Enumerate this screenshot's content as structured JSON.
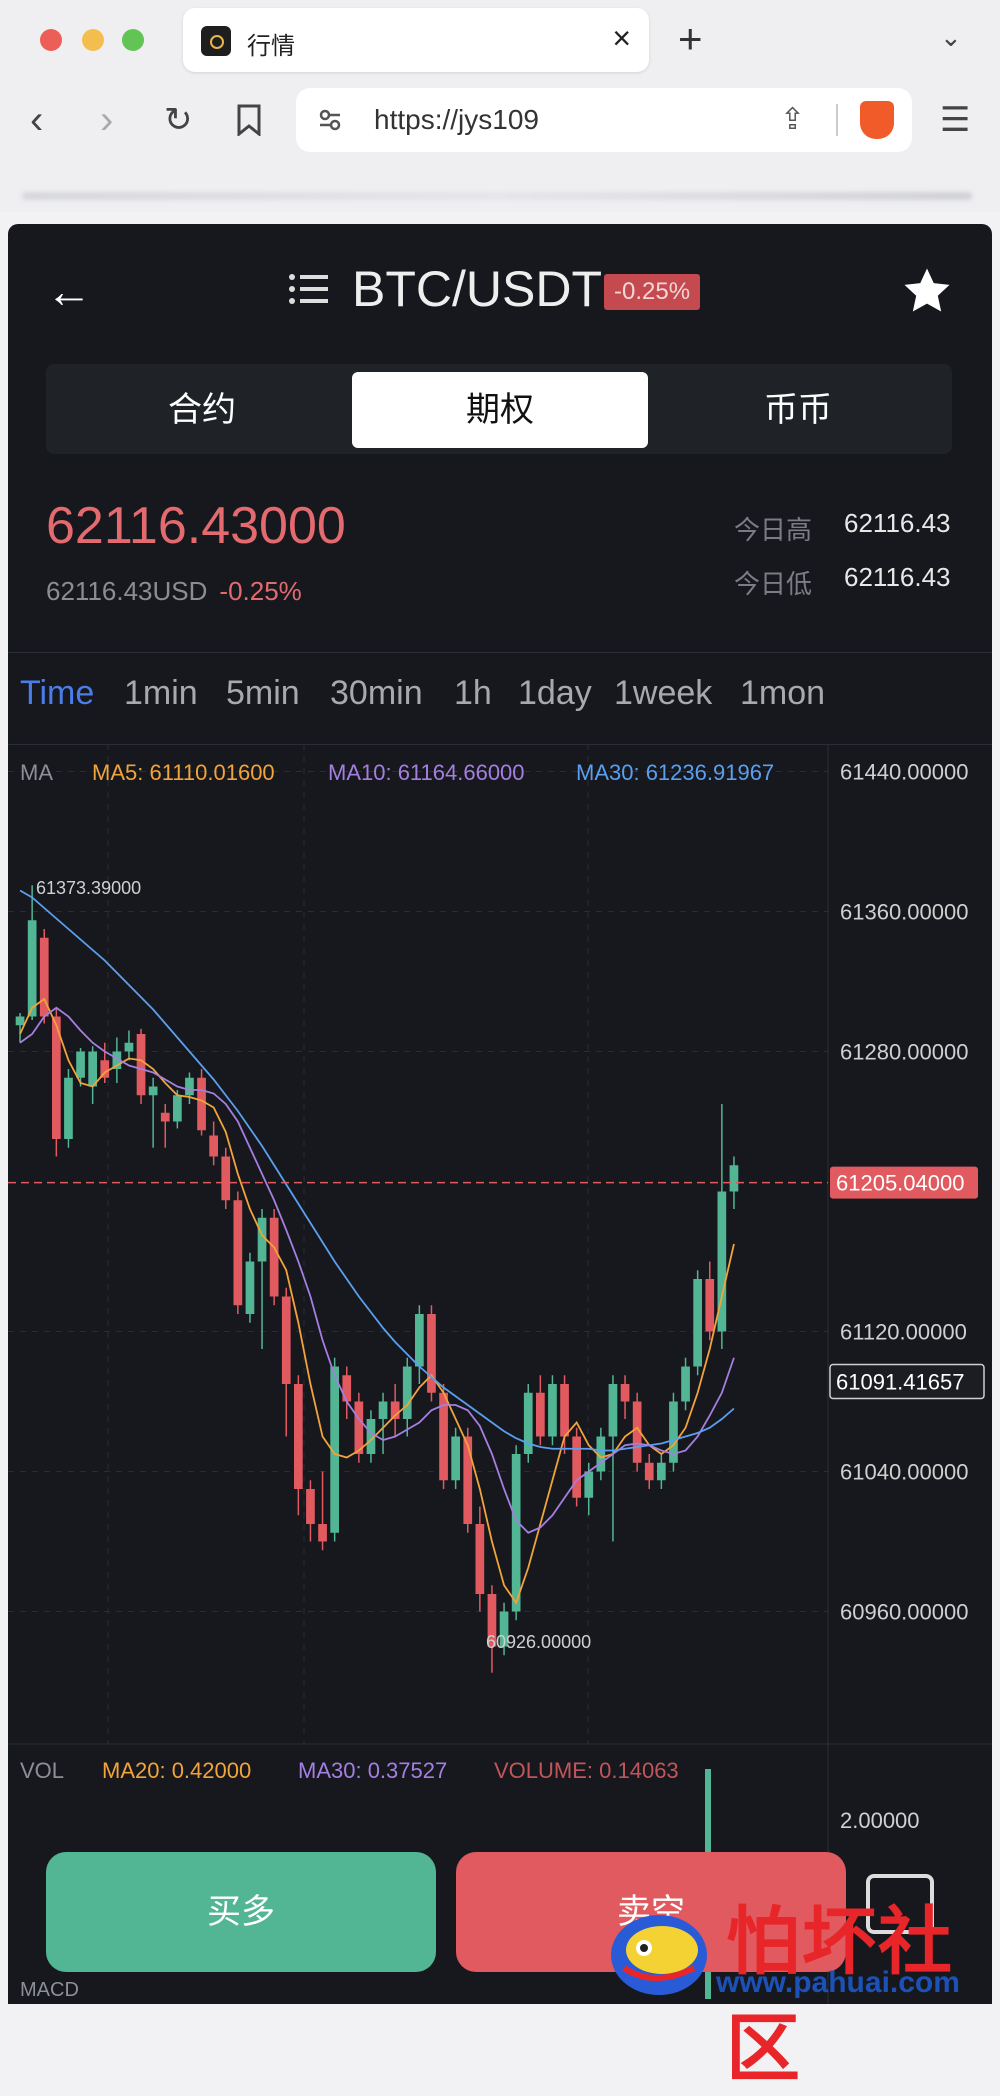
{
  "browser": {
    "tab_title": "行情",
    "tab_close": "×",
    "new_tab": "+",
    "url": "https://jys109"
  },
  "header": {
    "pair": "BTC/USDT",
    "change": "-0.25%"
  },
  "segments": [
    {
      "label": "合约",
      "active": false
    },
    {
      "label": "期权",
      "active": true
    },
    {
      "label": "币币",
      "active": false
    }
  ],
  "ticker": {
    "price": "62116.43000",
    "usd": "62116.43USD",
    "change": "-0.25%",
    "high_label": "今日高",
    "high_value": "62116.43",
    "low_label": "今日低",
    "low_value": "62116.43"
  },
  "timeframes": [
    "Time",
    "1min",
    "5min",
    "30min",
    "1h",
    "1day",
    "1week",
    "1mon"
  ],
  "active_timeframe": "Time",
  "chart_data": {
    "type": "candlestick",
    "ma_label": "MA",
    "ma5_text": "MA5: 61110.01600",
    "ma10_text": "MA10: 61164.66000",
    "ma30_text": "MA30: 61236.91967",
    "y_ticks": [
      "61440.00000",
      "61360.00000",
      "61280.00000",
      "61120.00000",
      "61040.00000",
      "60960.00000"
    ],
    "ylim": [
      60890,
      61450
    ],
    "last_price_label": "61205.04000",
    "cursor_price_label": "61091.41657",
    "last_price": 61205.04,
    "cursor_price": 61091.41657,
    "high_label": "61373.39000",
    "low_label": "60926.00000",
    "candles": [
      [
        61295,
        61300,
        61285,
        61302
      ],
      [
        61300,
        61355,
        61298,
        61375
      ],
      [
        61345,
        61300,
        61296,
        61350
      ],
      [
        61300,
        61230,
        61220,
        61305
      ],
      [
        61230,
        61265,
        61225,
        61270
      ],
      [
        61265,
        61280,
        61260,
        61282
      ],
      [
        61260,
        61280,
        61250,
        61283
      ],
      [
        61275,
        61265,
        61262,
        61285
      ],
      [
        61270,
        61280,
        61262,
        61288
      ],
      [
        61280,
        61285,
        61275,
        61292
      ],
      [
        61290,
        61255,
        61250,
        61293
      ],
      [
        61255,
        61260,
        61225,
        61265
      ],
      [
        61245,
        61240,
        61225,
        61250
      ],
      [
        61240,
        61255,
        61236,
        61258
      ],
      [
        61255,
        61265,
        61250,
        61268
      ],
      [
        61265,
        61235,
        61232,
        61270
      ],
      [
        61232,
        61220,
        61215,
        61240
      ],
      [
        61220,
        61195,
        61190,
        61225
      ],
      [
        61195,
        61135,
        61130,
        61200
      ],
      [
        61130,
        61160,
        61125,
        61165
      ],
      [
        61160,
        61185,
        61110,
        61190
      ],
      [
        61185,
        61140,
        61135,
        61190
      ],
      [
        61140,
        61090,
        61060,
        61145
      ],
      [
        61090,
        61030,
        61015,
        61095
      ],
      [
        61030,
        61010,
        61000,
        61035
      ],
      [
        61010,
        61000,
        60995,
        61040
      ],
      [
        61005,
        61100,
        61000,
        61105
      ],
      [
        61095,
        61080,
        61070,
        61100
      ],
      [
        61080,
        61050,
        61045,
        61085
      ],
      [
        61050,
        61070,
        61045,
        61075
      ],
      [
        61070,
        61080,
        61050,
        61085
      ],
      [
        61080,
        61070,
        61060,
        61090
      ],
      [
        61070,
        61100,
        61060,
        61105
      ],
      [
        61100,
        61130,
        61090,
        61135
      ],
      [
        61130,
        61085,
        61080,
        61135
      ],
      [
        61085,
        61035,
        61030,
        61090
      ],
      [
        61035,
        61060,
        61030,
        61065
      ],
      [
        61060,
        61010,
        61005,
        61065
      ],
      [
        61010,
        60970,
        60960,
        61020
      ],
      [
        60970,
        60940,
        60925,
        60975
      ],
      [
        60940,
        60960,
        60935,
        60965
      ],
      [
        60960,
        61050,
        60955,
        61055
      ],
      [
        61050,
        61085,
        61045,
        61090
      ],
      [
        61085,
        61060,
        61055,
        61095
      ],
      [
        61060,
        61090,
        61055,
        61095
      ],
      [
        61090,
        61060,
        61050,
        61095
      ],
      [
        61060,
        61025,
        61020,
        61065
      ],
      [
        61025,
        61040,
        61015,
        61045
      ],
      [
        61040,
        61060,
        61035,
        61065
      ],
      [
        61060,
        61090,
        61000,
        61095
      ],
      [
        61090,
        61080,
        61070,
        61095
      ],
      [
        61080,
        61045,
        61040,
        61085
      ],
      [
        61045,
        61035,
        61030,
        61050
      ],
      [
        61035,
        61045,
        61030,
        61050
      ],
      [
        61045,
        61080,
        61040,
        61085
      ],
      [
        61080,
        61100,
        61075,
        61105
      ],
      [
        61100,
        61150,
        61095,
        61155
      ],
      [
        61150,
        61120,
        61115,
        61160
      ],
      [
        61120,
        61200,
        61110,
        61250
      ],
      [
        61200,
        61215,
        61190,
        61220
      ]
    ],
    "ma5": [
      61290,
      61305,
      61310,
      61295,
      61275,
      61262,
      61260,
      61268,
      61272,
      61276,
      61275,
      61270,
      61262,
      61255,
      61254,
      61252,
      61248,
      61234,
      61210,
      61190,
      61175,
      61168,
      61155,
      61125,
      61090,
      61060,
      61050,
      61048,
      61052,
      61058,
      61065,
      61072,
      61078,
      61088,
      61095,
      61085,
      61070,
      61055,
      61030,
      61000,
      60975,
      60965,
      60985,
      61010,
      61035,
      61060,
      61068,
      61055,
      61048,
      61050,
      61060,
      61065,
      61055,
      61050,
      61055,
      61065,
      61085,
      61110,
      61140,
      61170
    ],
    "ma10": [
      61285,
      61290,
      61300,
      61305,
      61300,
      61292,
      61285,
      61280,
      61276,
      61272,
      61270,
      61268,
      61264,
      61260,
      61258,
      61258,
      61256,
      61250,
      61240,
      61225,
      61210,
      61195,
      61178,
      61160,
      61140,
      61115,
      61095,
      61080,
      61070,
      61062,
      61058,
      61060,
      61064,
      61068,
      61075,
      61078,
      61078,
      61075,
      61066,
      61050,
      61030,
      61012,
      61005,
      61008,
      61015,
      61025,
      61035,
      61040,
      61045,
      61050,
      61055,
      61056,
      61055,
      61052,
      61050,
      61052,
      61060,
      61072,
      61085,
      61105
    ],
    "ma30": [
      61372,
      61368,
      61362,
      61356,
      61350,
      61344,
      61338,
      61332,
      61325,
      61318,
      61311,
      61304,
      61296,
      61288,
      61280,
      61272,
      61264,
      61255,
      61246,
      61236,
      61226,
      61215,
      61204,
      61193,
      61182,
      61171,
      61160,
      61150,
      61140,
      61131,
      61122,
      61114,
      61107,
      61100,
      61094,
      61088,
      61083,
      61078,
      61073,
      61068,
      61063,
      61059,
      61056,
      61054,
      61053,
      61053,
      61053,
      61053,
      61052,
      61052,
      61053,
      61054,
      61055,
      61056,
      61058,
      61060,
      61062,
      61065,
      61070,
      61076
    ],
    "vol_label": "VOL",
    "vol_ma20_text": "MA20: 0.42000",
    "vol_ma30_text": "MA30: 0.37527",
    "vol_volume_text": "VOLUME: 0.14063",
    "vol_y_tick": "2.00000",
    "macd_text": "MACD"
  },
  "actions": {
    "buy_long": "买多",
    "sell_short": "卖空"
  },
  "watermark": {
    "cn": "怕坏社区",
    "url": "www.pahuai.com"
  },
  "colors": {
    "up": "#52b594",
    "down": "#e05a5f",
    "accent": "#4a7dea",
    "ma5": "#f2a33a",
    "ma10": "#a47fe0",
    "ma30": "#5a9ff0"
  }
}
